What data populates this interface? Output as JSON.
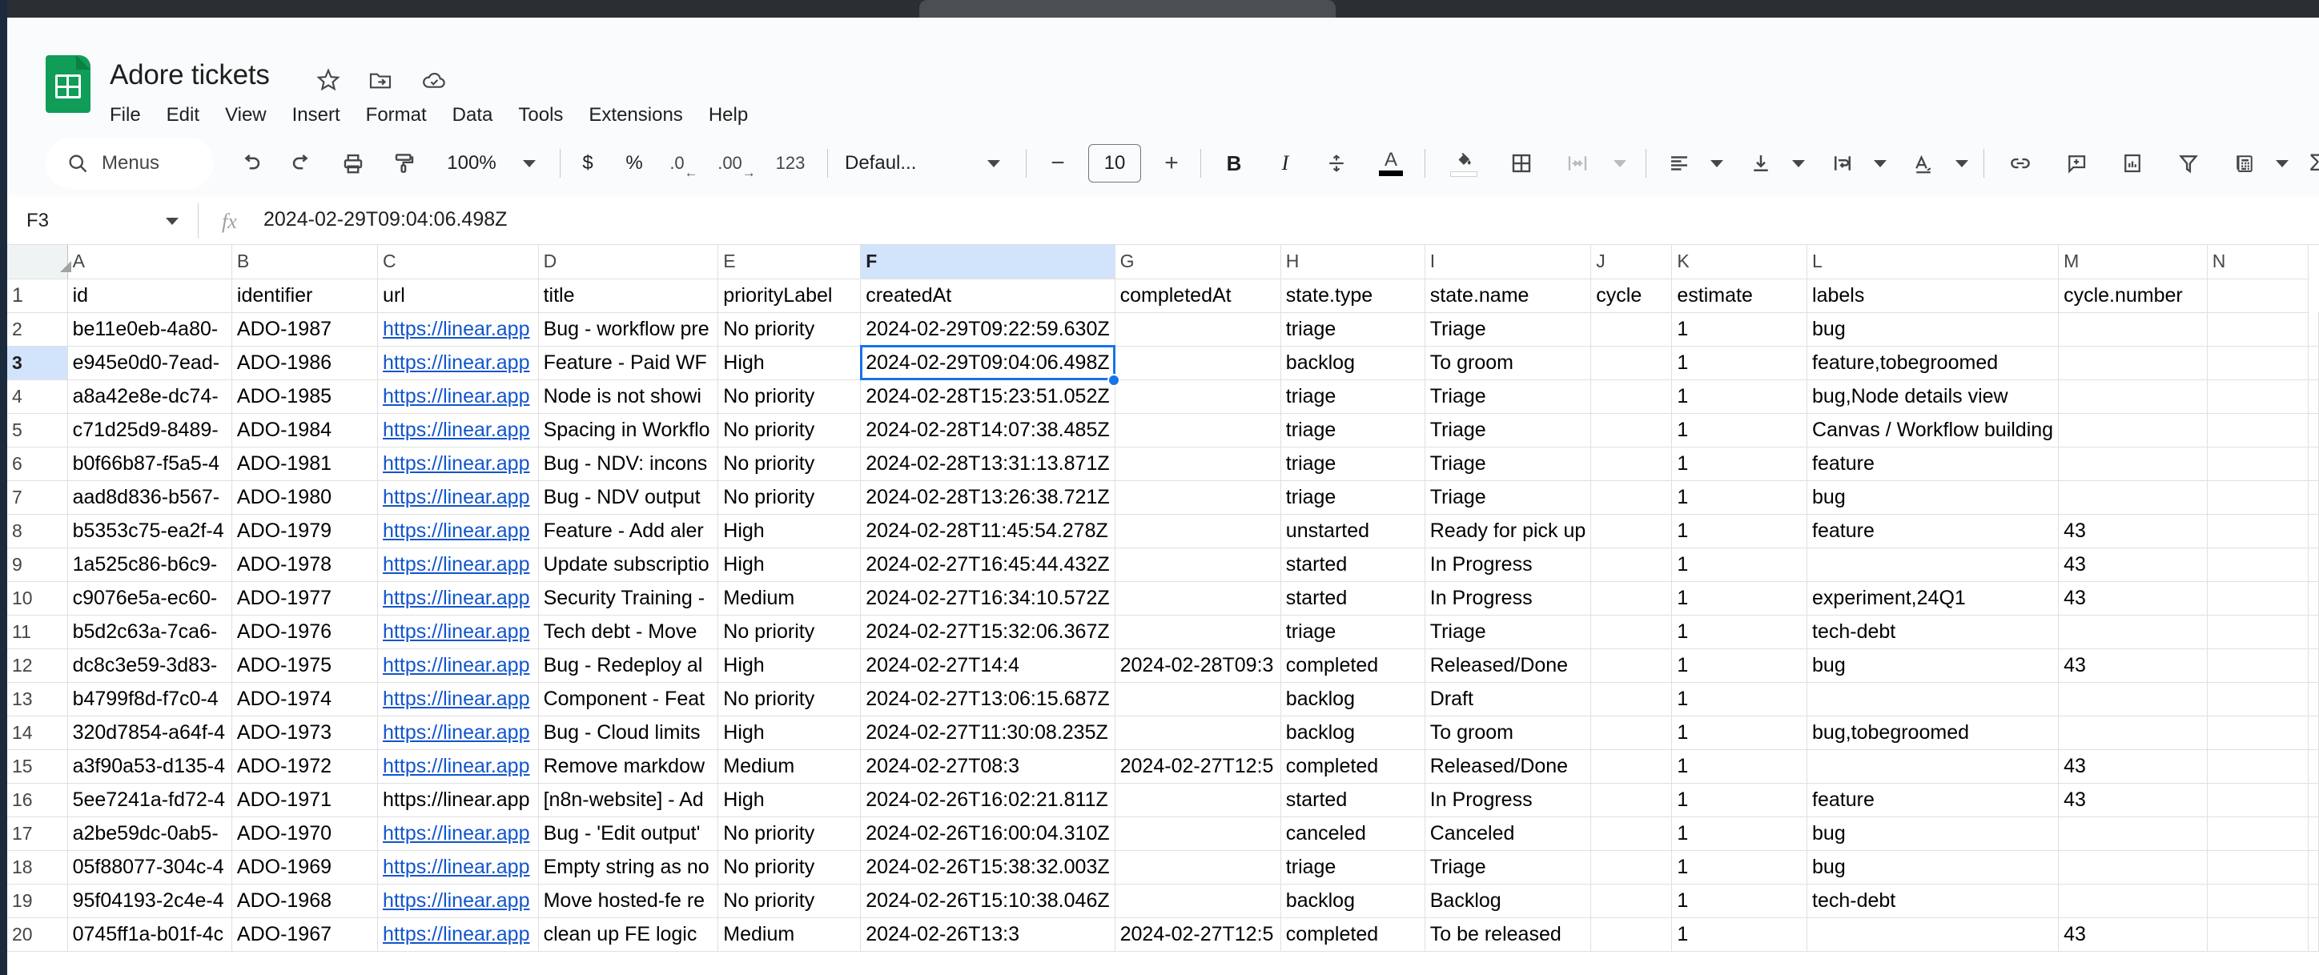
{
  "app": {
    "doc_title": "Adore tickets",
    "title_icons": [
      "star-icon",
      "move-to-folder-icon",
      "saved-to-drive-icon"
    ],
    "menus": [
      "File",
      "Edit",
      "View",
      "Insert",
      "Format",
      "Data",
      "Tools",
      "Extensions",
      "Help"
    ]
  },
  "toolbar": {
    "search_label": "Menus",
    "zoom_level": "100%",
    "currency_label": "$",
    "percent_label": "%",
    "decrease_decimal_label": ".0",
    "increase_decimal_label": ".00",
    "number_format_label": "123",
    "font_name": "Defaul...",
    "font_size": "10",
    "bold_label": "B",
    "italic_label": "I",
    "text_color_label": "A",
    "items": [
      "undo-icon",
      "redo-icon",
      "print-icon",
      "paint-format-icon",
      "currency-icon",
      "percent-icon",
      "decrease-decimal-icon",
      "increase-decimal-icon",
      "number-format-icon",
      "font-decrease-icon",
      "font-increase-icon",
      "bold-icon",
      "italic-icon",
      "strikethrough-icon",
      "text-color-icon",
      "fill-color-icon",
      "borders-icon",
      "merge-cells-icon",
      "horizontal-align-icon",
      "vertical-align-icon",
      "text-wrap-icon",
      "text-rotation-icon",
      "insert-link-icon",
      "insert-comment-icon",
      "insert-chart-icon",
      "filter-icon",
      "functions-icon",
      "sum-icon"
    ]
  },
  "formula_bar": {
    "name_box": "F3",
    "fx_label": "fx",
    "formula_value": "2024-02-29T09:04:06.498Z"
  },
  "grid": {
    "selected_cell": "F3",
    "selected_column": "F",
    "selected_row": "3",
    "column_letters": [
      "A",
      "B",
      "C",
      "D",
      "E",
      "F",
      "G",
      "H",
      "I",
      "J",
      "K",
      "L",
      "M",
      "N"
    ],
    "header_row_number": "1",
    "headers": [
      "id",
      "identifier",
      "url",
      "title",
      "priorityLabel",
      "createdAt",
      "completedAt",
      "state.type",
      "state.name",
      "cycle",
      "estimate",
      "labels",
      "cycle.number",
      ""
    ],
    "row_numbers": [
      "2",
      "3",
      "4",
      "5",
      "6",
      "7",
      "8",
      "9",
      "10",
      "11",
      "12",
      "13",
      "14",
      "15",
      "16",
      "17",
      "18",
      "19",
      "20"
    ],
    "url_text": "https://linear.app",
    "rows": [
      {
        "id": "be11e0eb-4a80-",
        "identifier": "ADO-1987",
        "url": "https://linear.app",
        "url_is_link": true,
        "title": "Bug - workflow pre",
        "priorityLabel": "No priority",
        "createdAt": "2024-02-29T09:22:59.630Z",
        "completedAt": "",
        "state_type": "triage",
        "state_name": "Triage",
        "cycle": "",
        "estimate": "1",
        "labels": "bug",
        "cycle_number": ""
      },
      {
        "id": "e945e0d0-7ead-",
        "identifier": "ADO-1986",
        "url": "https://linear.app",
        "url_is_link": true,
        "title": "Feature - Paid WF",
        "priorityLabel": "High",
        "createdAt": "2024-02-29T09:04:06.498Z",
        "completedAt": "",
        "state_type": "backlog",
        "state_name": "To groom",
        "cycle": "",
        "estimate": "1",
        "labels": "feature,tobegroomed",
        "cycle_number": ""
      },
      {
        "id": "a8a42e8e-dc74-",
        "identifier": "ADO-1985",
        "url": "https://linear.app",
        "url_is_link": true,
        "title": "Node is not showi",
        "priorityLabel": "No priority",
        "createdAt": "2024-02-28T15:23:51.052Z",
        "completedAt": "",
        "state_type": "triage",
        "state_name": "Triage",
        "cycle": "",
        "estimate": "1",
        "labels": "bug,Node details view",
        "cycle_number": ""
      },
      {
        "id": "c71d25d9-8489-",
        "identifier": "ADO-1984",
        "url": "https://linear.app",
        "url_is_link": true,
        "title": "Spacing in Workflo",
        "priorityLabel": "No priority",
        "createdAt": "2024-02-28T14:07:38.485Z",
        "completedAt": "",
        "state_type": "triage",
        "state_name": "Triage",
        "cycle": "",
        "estimate": "1",
        "labels": "Canvas / Workflow building",
        "cycle_number": ""
      },
      {
        "id": "b0f66b87-f5a5-4",
        "identifier": "ADO-1981",
        "url": "https://linear.app",
        "url_is_link": true,
        "title": "Bug - NDV: incons",
        "priorityLabel": "No priority",
        "createdAt": "2024-02-28T13:31:13.871Z",
        "completedAt": "",
        "state_type": "triage",
        "state_name": "Triage",
        "cycle": "",
        "estimate": "1",
        "labels": "feature",
        "cycle_number": ""
      },
      {
        "id": "aad8d836-b567-",
        "identifier": "ADO-1980",
        "url": "https://linear.app",
        "url_is_link": true,
        "title": "Bug - NDV output",
        "priorityLabel": "No priority",
        "createdAt": "2024-02-28T13:26:38.721Z",
        "completedAt": "",
        "state_type": "triage",
        "state_name": "Triage",
        "cycle": "",
        "estimate": "1",
        "labels": "bug",
        "cycle_number": ""
      },
      {
        "id": "b5353c75-ea2f-4",
        "identifier": "ADO-1979",
        "url": "https://linear.app",
        "url_is_link": true,
        "title": "Feature - Add aler",
        "priorityLabel": "High",
        "createdAt": "2024-02-28T11:45:54.278Z",
        "completedAt": "",
        "state_type": "unstarted",
        "state_name": "Ready for pick up",
        "cycle": "",
        "estimate": "1",
        "labels": "feature",
        "cycle_number": "43"
      },
      {
        "id": "1a525c86-b6c9-",
        "identifier": "ADO-1978",
        "url": "https://linear.app",
        "url_is_link": true,
        "title": "Update subscriptio",
        "priorityLabel": "High",
        "createdAt": "2024-02-27T16:45:44.432Z",
        "completedAt": "",
        "state_type": "started",
        "state_name": "In Progress",
        "cycle": "",
        "estimate": "1",
        "labels": "",
        "cycle_number": "43"
      },
      {
        "id": "c9076e5a-ec60-",
        "identifier": "ADO-1977",
        "url": "https://linear.app",
        "url_is_link": true,
        "title": "Security Training -",
        "priorityLabel": "Medium",
        "createdAt": "2024-02-27T16:34:10.572Z",
        "completedAt": "",
        "state_type": "started",
        "state_name": "In Progress",
        "cycle": "",
        "estimate": "1",
        "labels": "experiment,24Q1",
        "cycle_number": "43"
      },
      {
        "id": "b5d2c63a-7ca6-",
        "identifier": "ADO-1976",
        "url": "https://linear.app",
        "url_is_link": true,
        "title": "Tech debt - Move ",
        "priorityLabel": "No priority",
        "createdAt": "2024-02-27T15:32:06.367Z",
        "completedAt": "",
        "state_type": "triage",
        "state_name": "Triage",
        "cycle": "",
        "estimate": "1",
        "labels": "tech-debt",
        "cycle_number": ""
      },
      {
        "id": "dc8c3e59-3d83-",
        "identifier": "ADO-1975",
        "url": "https://linear.app",
        "url_is_link": true,
        "title": "Bug - Redeploy al",
        "priorityLabel": "High",
        "createdAt": "2024-02-27T14:4",
        "completedAt": "2024-02-28T09:3",
        "state_type": "completed",
        "state_name": "Released/Done",
        "cycle": "",
        "estimate": "1",
        "labels": "bug",
        "cycle_number": "43"
      },
      {
        "id": "b4799f8d-f7c0-4",
        "identifier": "ADO-1974",
        "url": "https://linear.app",
        "url_is_link": true,
        "title": "Component - Feat",
        "priorityLabel": "No priority",
        "createdAt": "2024-02-27T13:06:15.687Z",
        "completedAt": "",
        "state_type": "backlog",
        "state_name": "Draft",
        "cycle": "",
        "estimate": "1",
        "labels": "",
        "cycle_number": ""
      },
      {
        "id": "320d7854-a64f-4",
        "identifier": "ADO-1973",
        "url": "https://linear.app",
        "url_is_link": true,
        "title": "Bug - Cloud limits",
        "priorityLabel": "High",
        "createdAt": "2024-02-27T11:30:08.235Z",
        "completedAt": "",
        "state_type": "backlog",
        "state_name": "To groom",
        "cycle": "",
        "estimate": "1",
        "labels": "bug,tobegroomed",
        "cycle_number": ""
      },
      {
        "id": "a3f90a53-d135-4",
        "identifier": "ADO-1972",
        "url": "https://linear.app",
        "url_is_link": true,
        "title": "Remove markdow",
        "priorityLabel": "Medium",
        "createdAt": "2024-02-27T08:3",
        "completedAt": "2024-02-27T12:5",
        "state_type": "completed",
        "state_name": "Released/Done",
        "cycle": "",
        "estimate": "1",
        "labels": "",
        "cycle_number": "43"
      },
      {
        "id": "5ee7241a-fd72-4",
        "identifier": "ADO-1971",
        "url": "https://linear.app",
        "url_is_link": false,
        "title": "[n8n-website] - Ad",
        "priorityLabel": "High",
        "createdAt": "2024-02-26T16:02:21.811Z",
        "completedAt": "",
        "state_type": "started",
        "state_name": "In Progress",
        "cycle": "",
        "estimate": "1",
        "labels": "feature",
        "cycle_number": "43"
      },
      {
        "id": "a2be59dc-0ab5-",
        "identifier": "ADO-1970",
        "url": "https://linear.app",
        "url_is_link": true,
        "title": "Bug - 'Edit output'",
        "priorityLabel": "No priority",
        "createdAt": "2024-02-26T16:00:04.310Z",
        "completedAt": "",
        "state_type": "canceled",
        "state_name": "Canceled",
        "cycle": "",
        "estimate": "1",
        "labels": "bug",
        "cycle_number": ""
      },
      {
        "id": "05f88077-304c-4",
        "identifier": "ADO-1969",
        "url": "https://linear.app",
        "url_is_link": true,
        "title": "Empty string as no",
        "priorityLabel": "No priority",
        "createdAt": "2024-02-26T15:38:32.003Z",
        "completedAt": "",
        "state_type": "triage",
        "state_name": "Triage",
        "cycle": "",
        "estimate": "1",
        "labels": "bug",
        "cycle_number": ""
      },
      {
        "id": "95f04193-2c4e-4",
        "identifier": "ADO-1968",
        "url": "https://linear.app",
        "url_is_link": true,
        "title": "Move hosted-fe re",
        "priorityLabel": "No priority",
        "createdAt": "2024-02-26T15:10:38.046Z",
        "completedAt": "",
        "state_type": "backlog",
        "state_name": "Backlog",
        "cycle": "",
        "estimate": "1",
        "labels": "tech-debt",
        "cycle_number": ""
      },
      {
        "id": "0745ff1a-b01f-4c",
        "identifier": "ADO-1967",
        "url": "https://linear.app",
        "url_is_link": true,
        "title": "clean up FE logic",
        "priorityLabel": "Medium",
        "createdAt": "2024-02-26T13:3",
        "completedAt": "2024-02-27T12:5",
        "state_type": "completed",
        "state_name": "To be released",
        "cycle": "",
        "estimate": "1",
        "labels": "",
        "cycle_number": "43"
      }
    ]
  }
}
